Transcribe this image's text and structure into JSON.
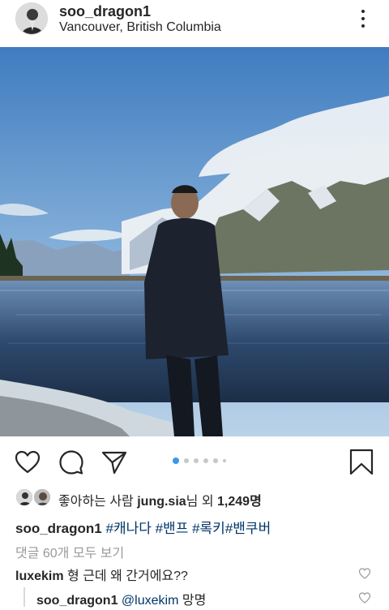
{
  "post": {
    "username": "soo_dragon1",
    "location": "Vancouver, British Columbia"
  },
  "icons": {
    "more": "more-vertical-icon",
    "like": "heart-icon",
    "comment": "comment-bubble-icon",
    "share": "send-paper-plane-icon",
    "save": "bookmark-icon"
  },
  "carousel": {
    "total_dots": 6,
    "active_index": 0
  },
  "likes": {
    "prefix": "좋아하는 사람 ",
    "user": "jung.sia",
    "middle": "님 외 ",
    "count": "1,249",
    "suffix": "명"
  },
  "caption": {
    "username": "soo_dragon1",
    "tags": [
      "#캐나다",
      "#밴프",
      "#록키",
      "#밴쿠버"
    ]
  },
  "comments": {
    "view_all": "댓글 60개 모두 보기",
    "items": [
      {
        "username": "luxekim",
        "text": "형 근데 왜 간거에요??"
      }
    ],
    "reply": {
      "username": "soo_dragon1",
      "mention": "@luxekim",
      "text": "망명"
    }
  },
  "colors": {
    "text": "#262626",
    "link": "#003569",
    "muted": "#999999",
    "carousel_active": "#3897f0"
  }
}
